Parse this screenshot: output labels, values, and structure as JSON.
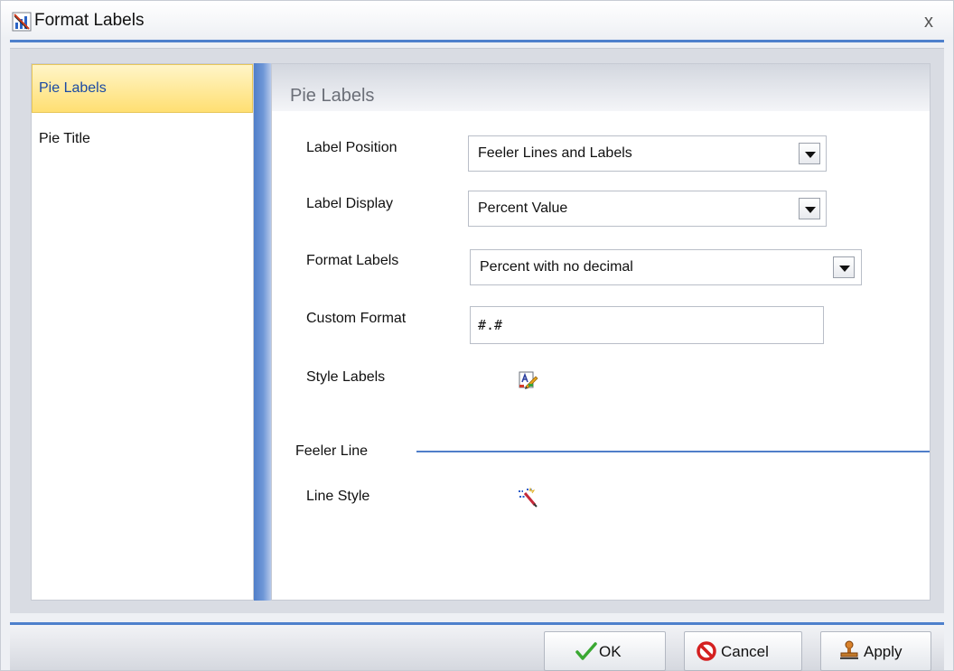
{
  "window": {
    "title": "Format Labels",
    "close_symbol": "x"
  },
  "nav": {
    "items": [
      {
        "label": "Pie Labels",
        "selected": true
      },
      {
        "label": "Pie Title",
        "selected": false
      }
    ]
  },
  "panel": {
    "title": "Pie Labels",
    "fields": {
      "label_position": {
        "label": "Label Position",
        "value": "Feeler Lines and Labels"
      },
      "label_display": {
        "label": "Label Display",
        "value": "Percent Value"
      },
      "format_labels": {
        "label": "Format Labels",
        "value": "Percent with no decimal"
      },
      "custom_format": {
        "label": "Custom Format",
        "value": "#.#"
      },
      "style_labels": {
        "label": "Style Labels",
        "icon": "style-labels-icon"
      }
    },
    "feeler_line": {
      "section_label": "Feeler Line",
      "line_style": {
        "label": "Line Style",
        "icon": "line-style-icon"
      }
    }
  },
  "footer": {
    "ok_label": "OK",
    "cancel_label": "Cancel",
    "apply_label": "Apply"
  },
  "colors": {
    "accent_blue": "#4e80cc",
    "selected_nav": "#ffdf72",
    "ok_check": "#3aa832",
    "cancel_red": "#d42020"
  }
}
